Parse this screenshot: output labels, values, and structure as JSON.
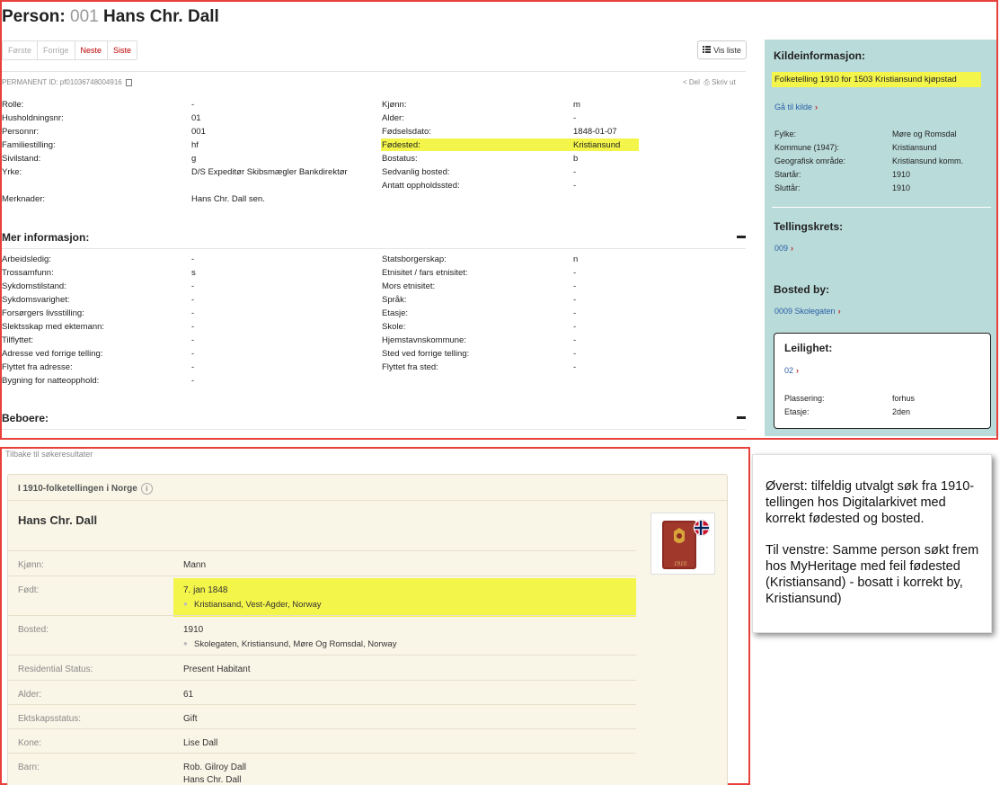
{
  "header": {
    "prefix": "Person:",
    "number": "001",
    "name": "Hans Chr. Dall"
  },
  "pager": {
    "first": "Første",
    "prev": "Forrige",
    "next": "Neste",
    "last": "Siste",
    "vis_liste": "Vis liste"
  },
  "permanent_id": "PERMANENT ID: pf01036748004916",
  "share": {
    "del": "Del",
    "print": "Skriv ut"
  },
  "fields_left": [
    {
      "label": "Rolle:",
      "value": "-"
    },
    {
      "label": "Husholdningsnr:",
      "value": "01"
    },
    {
      "label": "Personnr:",
      "value": "001"
    },
    {
      "label": "Familiestilling:",
      "value": "hf"
    },
    {
      "label": "Sivilstand:",
      "value": "g"
    },
    {
      "label": "Yrke:",
      "value": "D/S Expeditør Skibsmægler Bankdirektør"
    }
  ],
  "merknader": {
    "label": "Merknader:",
    "value": "Hans Chr. Dall sen."
  },
  "fields_right": [
    {
      "label": "Kjønn:",
      "value": "m"
    },
    {
      "label": "Alder:",
      "value": "-"
    },
    {
      "label": "Fødselsdato:",
      "value": "1848-01-07"
    },
    {
      "label": "Fødested:",
      "value": "Kristiansund"
    },
    {
      "label": "Bostatus:",
      "value": "b"
    },
    {
      "label": "Sedvanlig bosted:",
      "value": "-"
    },
    {
      "label": "Antatt oppholdssted:",
      "value": "-"
    }
  ],
  "mer_info": {
    "title": "Mer informasjon:",
    "left": [
      {
        "label": "Arbeidsledig:",
        "value": "-"
      },
      {
        "label": "Trossamfunn:",
        "value": "s"
      },
      {
        "label": "Sykdomstilstand:",
        "value": "-"
      },
      {
        "label": "Sykdomsvarighet:",
        "value": "-"
      },
      {
        "label": "Forsørgers livsstilling:",
        "value": "-"
      },
      {
        "label": "Slektsskap med ektemann:",
        "value": "-"
      },
      {
        "label": "Tilflyttet:",
        "value": "-"
      },
      {
        "label": "Adresse ved forrige telling:",
        "value": "-"
      },
      {
        "label": "Flyttet fra adresse:",
        "value": "-"
      },
      {
        "label": "Bygning for natteopphold:",
        "value": "-"
      }
    ],
    "right": [
      {
        "label": "Statsborgerskap:",
        "value": "n"
      },
      {
        "label": "Etnisitet / fars etnisitet:",
        "value": "-"
      },
      {
        "label": "Mors etnisitet:",
        "value": "-"
      },
      {
        "label": "Språk:",
        "value": "-"
      },
      {
        "label": "Etasje:",
        "value": "-"
      },
      {
        "label": "Skole:",
        "value": "-"
      },
      {
        "label": "Hjemstavnskommune:",
        "value": "-"
      },
      {
        "label": "Sted ved forrige telling:",
        "value": "-"
      },
      {
        "label": "Flyttet fra sted:",
        "value": "-"
      }
    ]
  },
  "beboere": {
    "title": "Beboere:"
  },
  "kilde": {
    "title": "Kildeinformasjon:",
    "source": "Folketelling 1910 for 1503 Kristiansund kjøpstad",
    "link": "Gå til kilde",
    "fields": [
      {
        "label": "Fylke:",
        "value": "Møre og Romsdal"
      },
      {
        "label": "Kommune (1947):",
        "value": "Kristiansund"
      },
      {
        "label": "Geografisk område:",
        "value": "Kristiansund komm."
      },
      {
        "label": "Startår:",
        "value": "1910"
      },
      {
        "label": "Sluttår:",
        "value": "1910"
      }
    ]
  },
  "tellingskrets": {
    "title": "Tellingskrets:",
    "link": "009"
  },
  "bosted_by": {
    "title": "Bosted by:",
    "link": "0009 Skolegaten"
  },
  "leilighet": {
    "title": "Leilighet:",
    "link": "02",
    "fields": [
      {
        "label": "Plassering:",
        "value": "forhus"
      },
      {
        "label": "Etasje:",
        "value": "2den"
      }
    ]
  },
  "myheritage": {
    "back": "Tilbake til søkeresultater",
    "heading": "I 1910-folketellingen i Norge",
    "name": "Hans Chr. Dall",
    "book_label": "1910",
    "rows": [
      {
        "label": "Kjønn:",
        "value": "Mann"
      },
      {
        "label": "Født:",
        "value": "7. jan 1848",
        "sub": "Kristiansand, Vest-Agder, Norway"
      },
      {
        "label": "Bosted:",
        "value": "1910",
        "sub": "Skolegaten, Kristiansund, Møre Og Romsdal, Norway"
      },
      {
        "label": "Residential Status:",
        "value": "Present Habitant"
      },
      {
        "label": "Alder:",
        "value": "61"
      },
      {
        "label": "Ektskapsstatus:",
        "value": "Gift"
      },
      {
        "label": "Kone:",
        "value": "Lise Dall"
      },
      {
        "label": "Barn:",
        "value": "Rob. Gilroy Dall",
        "sub2": "Hans Chr. Dall"
      }
    ]
  },
  "note": {
    "para1": "Øverst: tilfeldig utvalgt søk fra 1910-tellingen hos Digitalarkivet med korrekt fødested og bosted.",
    "para2": "Til venstre: Samme person søkt frem hos MyHeritage med feil fødested (Kristiansand) - bosatt  i korrekt by, Kristiansund)"
  },
  "colors": {
    "frame_red": "#e8403a",
    "highlight_yellow": "#f4f54a",
    "side_panel": "#b9dbda",
    "link_blue": "#2a5ea6",
    "pager_active_red": "#bb0000",
    "mh_card_bg": "#f9f5e7"
  }
}
